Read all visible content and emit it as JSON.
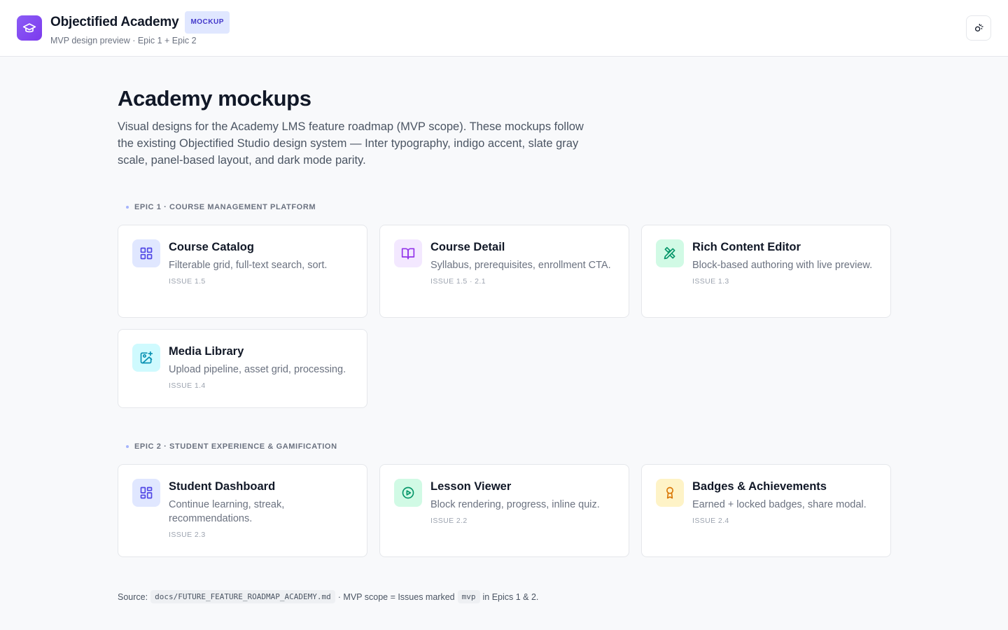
{
  "header": {
    "title": "Objectified Academy",
    "badge": "MOCKUP",
    "subtitle": "MVP design preview · Epic 1 + Epic 2"
  },
  "page": {
    "title": "Academy mockups",
    "intro": "Visual designs for the Academy LMS feature roadmap (MVP scope). These mockups follow the existing Objectified Studio design system — Inter typography, indigo accent, slate gray scale, panel-based layout, and dark mode parity."
  },
  "epic1": {
    "label": "EPIC 1 · COURSE MANAGEMENT PLATFORM",
    "cards": [
      {
        "title": "Course Catalog",
        "desc": "Filterable grid, full-text search, sort.",
        "issue": "ISSUE 1.5",
        "icon": "grid-icon",
        "icon_bg": "#e0e7ff",
        "icon_color": "#4f46e5"
      },
      {
        "title": "Course Detail",
        "desc": "Syllabus, prerequisites, enrollment CTA.",
        "issue": "ISSUE 1.5 · 2.1",
        "icon": "book-open-icon",
        "icon_bg": "#f3e8ff",
        "icon_color": "#9333ea"
      },
      {
        "title": "Rich Content Editor",
        "desc": "Block-based authoring with live preview.",
        "issue": "ISSUE 1.3",
        "icon": "pencil-ruler-icon",
        "icon_bg": "#d1fae5",
        "icon_color": "#059669"
      },
      {
        "title": "Media Library",
        "desc": "Upload pipeline, asset grid, processing.",
        "issue": "ISSUE 1.4",
        "icon": "image-plus-icon",
        "icon_bg": "#cffafe",
        "icon_color": "#0891b2"
      }
    ]
  },
  "epic2": {
    "label": "EPIC 2 · STUDENT EXPERIENCE & GAMIFICATION",
    "cards": [
      {
        "title": "Student Dashboard",
        "desc": "Continue learning, streak, recommendations.",
        "issue": "ISSUE 2.3",
        "icon": "dashboard-icon",
        "icon_bg": "#e0e7ff",
        "icon_color": "#4f46e5"
      },
      {
        "title": "Lesson Viewer",
        "desc": "Block rendering, progress, inline quiz.",
        "issue": "ISSUE 2.2",
        "icon": "play-circle-icon",
        "icon_bg": "#d1fae5",
        "icon_color": "#059669"
      },
      {
        "title": "Badges & Achievements",
        "desc": "Earned + locked badges, share modal.",
        "issue": "ISSUE 2.4",
        "icon": "award-icon",
        "icon_bg": "#fef3c7",
        "icon_color": "#d97706"
      }
    ]
  },
  "footer": {
    "source_label": "Source:",
    "source_path": "docs/FUTURE_FEATURE_ROADMAP_ACADEMY.md",
    "middle_text": "· MVP scope = Issues marked",
    "code_tag": "mvp",
    "end_text": "in Epics 1 & 2."
  }
}
